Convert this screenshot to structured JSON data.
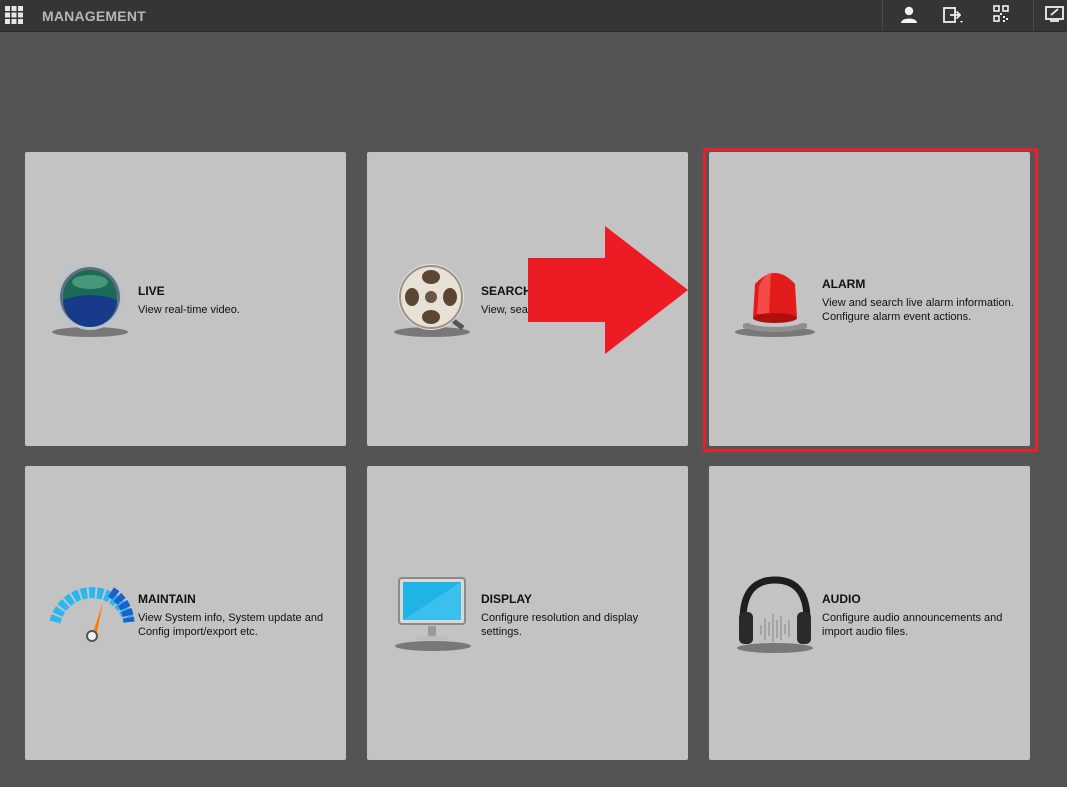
{
  "header": {
    "title": "MANAGEMENT",
    "icons": [
      "apps-grid-icon",
      "user-icon",
      "logout-icon",
      "qr-code-icon",
      "monitor-icon"
    ]
  },
  "tiles": [
    {
      "key": "live",
      "label": "LIVE",
      "description": "View real-time video.",
      "icon": "live-globe-icon"
    },
    {
      "key": "search",
      "label": "SEARCH",
      "description": "View, search and playback videos",
      "icon": "film-reel-icon"
    },
    {
      "key": "alarm",
      "label": "ALARM",
      "description": "View and search live alarm information. Configure alarm event actions.",
      "icon": "alarm-siren-icon"
    },
    {
      "key": "maintain",
      "label": "MAINTAIN",
      "description": "View System info, System update and Config import/export etc.",
      "icon": "speedometer-icon"
    },
    {
      "key": "display",
      "label": "DISPLAY",
      "description": "Configure resolution and display settings.",
      "icon": "display-monitor-icon"
    },
    {
      "key": "audio",
      "label": "AUDIO",
      "description": "Configure audio announcements and import audio files.",
      "icon": "headphones-icon"
    }
  ],
  "annotation": {
    "highlighted_tile": "alarm",
    "arrow_color": "#ed1c24",
    "box_color": "#e8202a"
  }
}
